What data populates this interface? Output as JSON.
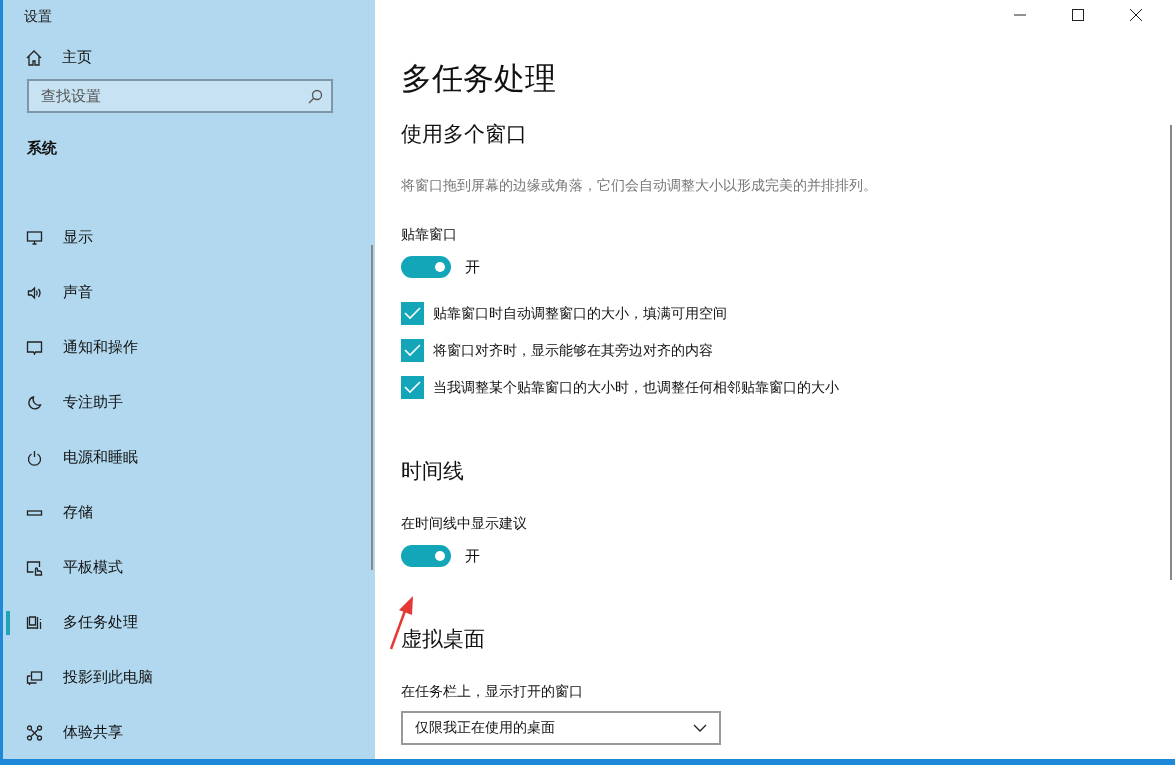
{
  "window": {
    "title": "设置"
  },
  "sidebar": {
    "home": "主页",
    "search": {
      "placeholder": "查找设置"
    },
    "section": "系统",
    "items": [
      {
        "label": "显示",
        "selected": false
      },
      {
        "label": "声音",
        "selected": false
      },
      {
        "label": "通知和操作",
        "selected": false
      },
      {
        "label": "专注助手",
        "selected": false
      },
      {
        "label": "电源和睡眠",
        "selected": false
      },
      {
        "label": "存储",
        "selected": false
      },
      {
        "label": "平板模式",
        "selected": false
      },
      {
        "label": "多任务处理",
        "selected": true
      },
      {
        "label": "投影到此电脑",
        "selected": false
      },
      {
        "label": "体验共享",
        "selected": false
      }
    ]
  },
  "page": {
    "title": "多任务处理",
    "sections": [
      {
        "heading": "使用多个窗口",
        "items": [
          {
            "kind": "description",
            "text": "将窗口拖到屏幕的边缘或角落，它们会自动调整大小以形成完美的并排排列。"
          },
          {
            "kind": "toggle",
            "label": "贴靠窗口",
            "on": true,
            "state_text": "开"
          },
          {
            "kind": "checkbox",
            "label": "贴靠窗口时自动调整窗口的大小，填满可用空间",
            "checked": true
          },
          {
            "kind": "checkbox",
            "label": "将窗口对齐时，显示能够在其旁边对齐的内容",
            "checked": true
          },
          {
            "kind": "checkbox",
            "label": "当我调整某个贴靠窗口的大小时，也调整任何相邻贴靠窗口的大小",
            "checked": true
          }
        ]
      },
      {
        "heading": "时间线",
        "items": [
          {
            "kind": "toggle",
            "label": "在时间线中显示建议",
            "on": true,
            "state_text": "开"
          }
        ]
      },
      {
        "heading": "虚拟桌面",
        "items": [
          {
            "kind": "dropdown",
            "label": "在任务栏上，显示打开的窗口",
            "value": "仅限我正在使用的桌面"
          }
        ]
      }
    ]
  }
}
